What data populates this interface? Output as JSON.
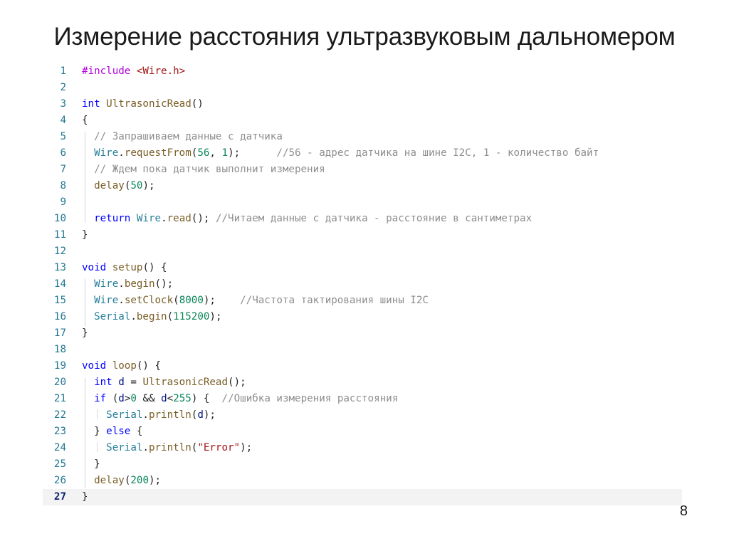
{
  "slide": {
    "title": "Измерение расстояния ультразвуковым дальномером",
    "page_number": "8"
  },
  "code": {
    "language": "C++ (Arduino)",
    "lines": [
      [
        {
          "t": "#include ",
          "k": "pp"
        },
        {
          "t": "<Wire.h>",
          "k": "str"
        }
      ],
      [],
      [
        {
          "t": "int",
          "k": "kw"
        },
        {
          "t": " ",
          "k": "op"
        },
        {
          "t": "UltrasonicRead",
          "k": "fn"
        },
        {
          "t": "()",
          "k": "op"
        }
      ],
      [
        {
          "t": "{",
          "k": "op"
        }
      ],
      [
        {
          "t": "  ",
          "k": "op"
        },
        {
          "t": "// Запрашиваем данные с датчика",
          "k": "cm"
        }
      ],
      [
        {
          "t": "  ",
          "k": "op"
        },
        {
          "t": "Wire",
          "k": "cls"
        },
        {
          "t": ".",
          "k": "op"
        },
        {
          "t": "requestFrom",
          "k": "fn"
        },
        {
          "t": "(",
          "k": "op"
        },
        {
          "t": "56",
          "k": "num"
        },
        {
          "t": ", ",
          "k": "op"
        },
        {
          "t": "1",
          "k": "num"
        },
        {
          "t": ");      ",
          "k": "op"
        },
        {
          "t": "//56 - адрес датчика на шине I2C, 1 - количество байт",
          "k": "cm"
        }
      ],
      [
        {
          "t": "  ",
          "k": "op"
        },
        {
          "t": "// Ждем пока датчик выполнит измерения",
          "k": "cm"
        }
      ],
      [
        {
          "t": "  ",
          "k": "op"
        },
        {
          "t": "delay",
          "k": "fn"
        },
        {
          "t": "(",
          "k": "op"
        },
        {
          "t": "50",
          "k": "num"
        },
        {
          "t": ");",
          "k": "op"
        }
      ],
      [],
      [
        {
          "t": "  ",
          "k": "op"
        },
        {
          "t": "return",
          "k": "kw"
        },
        {
          "t": " ",
          "k": "op"
        },
        {
          "t": "Wire",
          "k": "cls"
        },
        {
          "t": ".",
          "k": "op"
        },
        {
          "t": "read",
          "k": "fn"
        },
        {
          "t": "(); ",
          "k": "op"
        },
        {
          "t": "//Читаем данные с датчика - расстояние в сантиметрах",
          "k": "cm"
        }
      ],
      [
        {
          "t": "}",
          "k": "op"
        }
      ],
      [],
      [
        {
          "t": "void",
          "k": "kw"
        },
        {
          "t": " ",
          "k": "op"
        },
        {
          "t": "setup",
          "k": "fn"
        },
        {
          "t": "() {",
          "k": "op"
        }
      ],
      [
        {
          "t": "  ",
          "k": "op"
        },
        {
          "t": "Wire",
          "k": "cls"
        },
        {
          "t": ".",
          "k": "op"
        },
        {
          "t": "begin",
          "k": "fn"
        },
        {
          "t": "();",
          "k": "op"
        }
      ],
      [
        {
          "t": "  ",
          "k": "op"
        },
        {
          "t": "Wire",
          "k": "cls"
        },
        {
          "t": ".",
          "k": "op"
        },
        {
          "t": "setClock",
          "k": "fn"
        },
        {
          "t": "(",
          "k": "op"
        },
        {
          "t": "8000",
          "k": "num"
        },
        {
          "t": ");    ",
          "k": "op"
        },
        {
          "t": "//Частота тактирования шины I2C",
          "k": "cm"
        }
      ],
      [
        {
          "t": "  ",
          "k": "op"
        },
        {
          "t": "Serial",
          "k": "cls"
        },
        {
          "t": ".",
          "k": "op"
        },
        {
          "t": "begin",
          "k": "fn"
        },
        {
          "t": "(",
          "k": "op"
        },
        {
          "t": "115200",
          "k": "num"
        },
        {
          "t": ");",
          "k": "op"
        }
      ],
      [
        {
          "t": "}",
          "k": "op"
        }
      ],
      [],
      [
        {
          "t": "void",
          "k": "kw"
        },
        {
          "t": " ",
          "k": "op"
        },
        {
          "t": "loop",
          "k": "fn"
        },
        {
          "t": "() {",
          "k": "op"
        }
      ],
      [
        {
          "t": "  ",
          "k": "op"
        },
        {
          "t": "int",
          "k": "kw"
        },
        {
          "t": " ",
          "k": "op"
        },
        {
          "t": "d",
          "k": "id"
        },
        {
          "t": " = ",
          "k": "op"
        },
        {
          "t": "UltrasonicRead",
          "k": "fn"
        },
        {
          "t": "();",
          "k": "op"
        }
      ],
      [
        {
          "t": "  ",
          "k": "op"
        },
        {
          "t": "if",
          "k": "kw"
        },
        {
          "t": " (",
          "k": "op"
        },
        {
          "t": "d",
          "k": "id"
        },
        {
          "t": ">",
          "k": "op"
        },
        {
          "t": "0",
          "k": "num"
        },
        {
          "t": " && ",
          "k": "op"
        },
        {
          "t": "d",
          "k": "id"
        },
        {
          "t": "<",
          "k": "op"
        },
        {
          "t": "255",
          "k": "num"
        },
        {
          "t": ") {  ",
          "k": "op"
        },
        {
          "t": "//Ошибка измерения расстояния",
          "k": "cm"
        }
      ],
      [
        {
          "t": "    ",
          "k": "op"
        },
        {
          "t": "Serial",
          "k": "cls"
        },
        {
          "t": ".",
          "k": "op"
        },
        {
          "t": "println",
          "k": "fn"
        },
        {
          "t": "(",
          "k": "op"
        },
        {
          "t": "d",
          "k": "id"
        },
        {
          "t": ");",
          "k": "op"
        }
      ],
      [
        {
          "t": "  } ",
          "k": "op"
        },
        {
          "t": "else",
          "k": "kw"
        },
        {
          "t": " {",
          "k": "op"
        }
      ],
      [
        {
          "t": "    ",
          "k": "op"
        },
        {
          "t": "Serial",
          "k": "cls"
        },
        {
          "t": ".",
          "k": "op"
        },
        {
          "t": "println",
          "k": "fn"
        },
        {
          "t": "(",
          "k": "op"
        },
        {
          "t": "\"Error\"",
          "k": "str"
        },
        {
          "t": ");",
          "k": "op"
        }
      ],
      [
        {
          "t": "  }",
          "k": "op"
        }
      ],
      [
        {
          "t": "  ",
          "k": "op"
        },
        {
          "t": "delay",
          "k": "fn"
        },
        {
          "t": "(",
          "k": "op"
        },
        {
          "t": "200",
          "k": "num"
        },
        {
          "t": ");",
          "k": "op"
        }
      ],
      [
        {
          "t": "}",
          "k": "op"
        }
      ]
    ],
    "current_line": 27
  }
}
